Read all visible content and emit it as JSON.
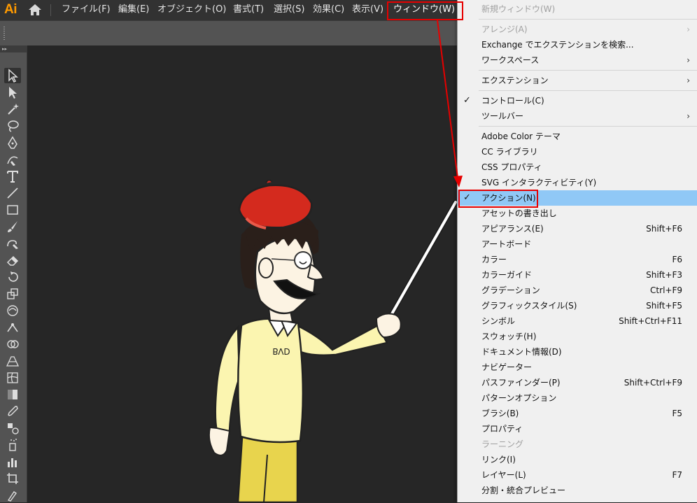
{
  "app": {
    "logo": "Ai"
  },
  "menubar": {
    "items": [
      "ファイル(F)",
      "編集(E)",
      "オブジェクト(O)",
      "書式(T)",
      "選択(S)",
      "効果(C)",
      "表示(V)",
      "ウィンドウ(W)"
    ],
    "active_index": 7
  },
  "toolbar": {
    "tools": [
      "selection-tool",
      "direct-selection-tool",
      "magic-wand-tool",
      "lasso-tool",
      "pen-tool",
      "curvature-tool",
      "type-tool",
      "line-segment-tool",
      "rectangle-tool",
      "paintbrush-tool",
      "shaper-tool",
      "eraser-tool",
      "rotate-tool",
      "scale-tool",
      "warp-tool",
      "puppet-warp-tool",
      "shape-builder-tool",
      "perspective-grid-tool",
      "mesh-tool",
      "gradient-tool",
      "eyedropper-tool",
      "blend-tool",
      "symbol-sprayer-tool",
      "column-graph-tool",
      "artboard-tool",
      "slice-tool"
    ],
    "selected_index": 0
  },
  "artwork": {
    "shirt_text": "BVD"
  },
  "window_menu": {
    "items": [
      {
        "label": "新規ウィンドウ(W)",
        "disabled": true
      },
      {
        "separator": true
      },
      {
        "label": "アレンジ(A)",
        "disabled": true,
        "submenu": true
      },
      {
        "label": "Exchange でエクステンションを検索..."
      },
      {
        "label": "ワークスペース",
        "submenu": true
      },
      {
        "separator": true
      },
      {
        "label": "エクステンション",
        "submenu": true
      },
      {
        "separator": true
      },
      {
        "label": "コントロール(C)",
        "checked": true
      },
      {
        "label": "ツールバー",
        "submenu": true
      },
      {
        "separator": true
      },
      {
        "label": "Adobe Color テーマ"
      },
      {
        "label": "CC ライブラリ"
      },
      {
        "label": "CSS プロパティ"
      },
      {
        "label": "SVG インタラクティビティ(Y)"
      },
      {
        "label": "アクション(N)",
        "checked": true,
        "highlighted": true
      },
      {
        "label": "アセットの書き出し"
      },
      {
        "label": "アピアランス(E)",
        "shortcut": "Shift+F6"
      },
      {
        "label": "アートボード"
      },
      {
        "label": "カラー",
        "shortcut": "F6"
      },
      {
        "label": "カラーガイド",
        "shortcut": "Shift+F3"
      },
      {
        "label": "グラデーション",
        "shortcut": "Ctrl+F9"
      },
      {
        "label": "グラフィックスタイル(S)",
        "shortcut": "Shift+F5"
      },
      {
        "label": "シンボル",
        "shortcut": "Shift+Ctrl+F11"
      },
      {
        "label": "スウォッチ(H)"
      },
      {
        "label": "ドキュメント情報(D)"
      },
      {
        "label": "ナビゲーター"
      },
      {
        "label": "パスファインダー(P)",
        "shortcut": "Shift+Ctrl+F9"
      },
      {
        "label": "パターンオプション"
      },
      {
        "label": "ブラシ(B)",
        "shortcut": "F5"
      },
      {
        "label": "プロパティ"
      },
      {
        "label": "ラーニング",
        "disabled": true
      },
      {
        "label": "リンク(I)"
      },
      {
        "label": "レイヤー(L)",
        "shortcut": "F7"
      },
      {
        "label": "分割・統合プレビュー"
      }
    ]
  },
  "annotation_color": "#e60000"
}
